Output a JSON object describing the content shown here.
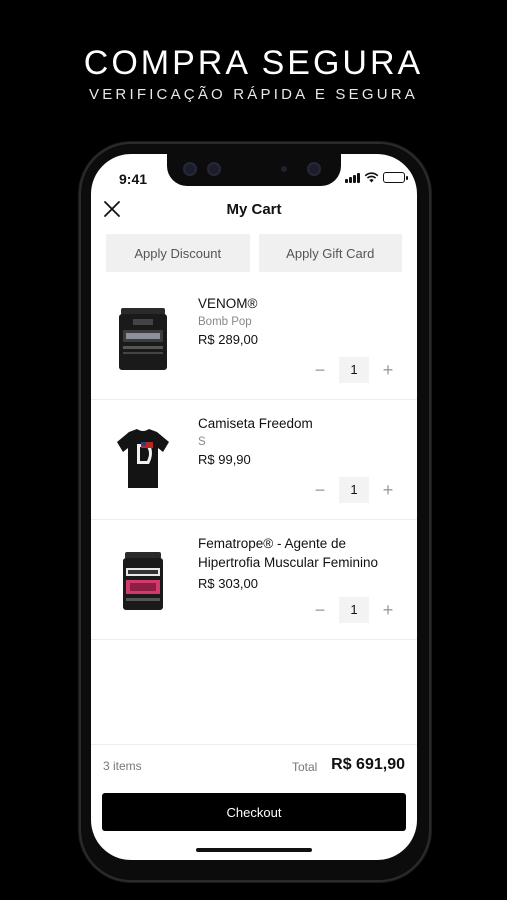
{
  "promo": {
    "headline": "COMPRA SEGURA",
    "subline": "VERIFICAÇÃO RÁPIDA E SEGURA"
  },
  "status_bar": {
    "time": "9:41",
    "battery_color": "#34c759"
  },
  "nav": {
    "title": "My Cart",
    "close_icon": "close-x"
  },
  "actions": {
    "discount_label": "Apply Discount",
    "gift_card_label": "Apply Gift Card"
  },
  "cart": {
    "items": [
      {
        "name": "VENOM®",
        "variant": "Bomb Pop",
        "price": "R$ 289,00",
        "quantity": "1",
        "image": "supplement-tub-black"
      },
      {
        "name": "Camiseta Freedom",
        "variant": "S",
        "price": "R$ 99,90",
        "quantity": "1",
        "image": "t-shirt-black"
      },
      {
        "name": "Fematrope® - Agente de Hipertrofia Muscular Feminino",
        "variant": "",
        "price": "R$ 303,00",
        "quantity": "1",
        "image": "supplement-tub-pink"
      }
    ],
    "minus_symbol": "−",
    "plus_symbol": "+"
  },
  "footer": {
    "count": "3 items",
    "total_label": "Total",
    "total_value": "R$ 691,90",
    "checkout_label": "Checkout"
  }
}
